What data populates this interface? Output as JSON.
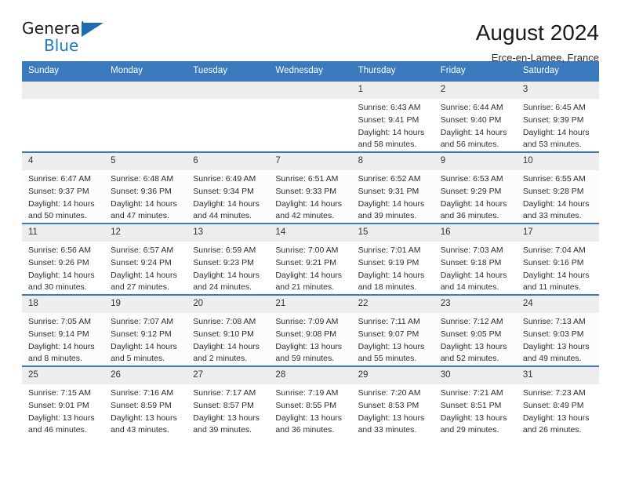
{
  "brand": {
    "name_top": "General",
    "name_bottom": "Blue",
    "triangle_color": "#1b6cb3",
    "blue_text_color": "#1f7ac4"
  },
  "header": {
    "title": "August 2024",
    "location": "Erce-en-Lamee, France"
  },
  "theme": {
    "header_blue": "#3a7abd",
    "daynum_band": "#ededed",
    "row_separator": "#3a7abd"
  },
  "columns": [
    "Sunday",
    "Monday",
    "Tuesday",
    "Wednesday",
    "Thursday",
    "Friday",
    "Saturday"
  ],
  "weeks": [
    [
      {
        "day": "",
        "empty": true,
        "sunrise": "",
        "sunset": "",
        "daylight1": "",
        "daylight2": ""
      },
      {
        "day": "",
        "empty": true,
        "sunrise": "",
        "sunset": "",
        "daylight1": "",
        "daylight2": ""
      },
      {
        "day": "",
        "empty": true,
        "sunrise": "",
        "sunset": "",
        "daylight1": "",
        "daylight2": ""
      },
      {
        "day": "",
        "empty": true,
        "sunrise": "",
        "sunset": "",
        "daylight1": "",
        "daylight2": ""
      },
      {
        "day": "1",
        "sunrise": "Sunrise: 6:43 AM",
        "sunset": "Sunset: 9:41 PM",
        "daylight1": "Daylight: 14 hours",
        "daylight2": "and 58 minutes."
      },
      {
        "day": "2",
        "sunrise": "Sunrise: 6:44 AM",
        "sunset": "Sunset: 9:40 PM",
        "daylight1": "Daylight: 14 hours",
        "daylight2": "and 56 minutes."
      },
      {
        "day": "3",
        "sunrise": "Sunrise: 6:45 AM",
        "sunset": "Sunset: 9:39 PM",
        "daylight1": "Daylight: 14 hours",
        "daylight2": "and 53 minutes."
      }
    ],
    [
      {
        "day": "4",
        "sunrise": "Sunrise: 6:47 AM",
        "sunset": "Sunset: 9:37 PM",
        "daylight1": "Daylight: 14 hours",
        "daylight2": "and 50 minutes."
      },
      {
        "day": "5",
        "sunrise": "Sunrise: 6:48 AM",
        "sunset": "Sunset: 9:36 PM",
        "daylight1": "Daylight: 14 hours",
        "daylight2": "and 47 minutes."
      },
      {
        "day": "6",
        "sunrise": "Sunrise: 6:49 AM",
        "sunset": "Sunset: 9:34 PM",
        "daylight1": "Daylight: 14 hours",
        "daylight2": "and 44 minutes."
      },
      {
        "day": "7",
        "sunrise": "Sunrise: 6:51 AM",
        "sunset": "Sunset: 9:33 PM",
        "daylight1": "Daylight: 14 hours",
        "daylight2": "and 42 minutes."
      },
      {
        "day": "8",
        "sunrise": "Sunrise: 6:52 AM",
        "sunset": "Sunset: 9:31 PM",
        "daylight1": "Daylight: 14 hours",
        "daylight2": "and 39 minutes."
      },
      {
        "day": "9",
        "sunrise": "Sunrise: 6:53 AM",
        "sunset": "Sunset: 9:29 PM",
        "daylight1": "Daylight: 14 hours",
        "daylight2": "and 36 minutes."
      },
      {
        "day": "10",
        "sunrise": "Sunrise: 6:55 AM",
        "sunset": "Sunset: 9:28 PM",
        "daylight1": "Daylight: 14 hours",
        "daylight2": "and 33 minutes."
      }
    ],
    [
      {
        "day": "11",
        "sunrise": "Sunrise: 6:56 AM",
        "sunset": "Sunset: 9:26 PM",
        "daylight1": "Daylight: 14 hours",
        "daylight2": "and 30 minutes."
      },
      {
        "day": "12",
        "sunrise": "Sunrise: 6:57 AM",
        "sunset": "Sunset: 9:24 PM",
        "daylight1": "Daylight: 14 hours",
        "daylight2": "and 27 minutes."
      },
      {
        "day": "13",
        "sunrise": "Sunrise: 6:59 AM",
        "sunset": "Sunset: 9:23 PM",
        "daylight1": "Daylight: 14 hours",
        "daylight2": "and 24 minutes."
      },
      {
        "day": "14",
        "sunrise": "Sunrise: 7:00 AM",
        "sunset": "Sunset: 9:21 PM",
        "daylight1": "Daylight: 14 hours",
        "daylight2": "and 21 minutes."
      },
      {
        "day": "15",
        "sunrise": "Sunrise: 7:01 AM",
        "sunset": "Sunset: 9:19 PM",
        "daylight1": "Daylight: 14 hours",
        "daylight2": "and 18 minutes."
      },
      {
        "day": "16",
        "sunrise": "Sunrise: 7:03 AM",
        "sunset": "Sunset: 9:18 PM",
        "daylight1": "Daylight: 14 hours",
        "daylight2": "and 14 minutes."
      },
      {
        "day": "17",
        "sunrise": "Sunrise: 7:04 AM",
        "sunset": "Sunset: 9:16 PM",
        "daylight1": "Daylight: 14 hours",
        "daylight2": "and 11 minutes."
      }
    ],
    [
      {
        "day": "18",
        "sunrise": "Sunrise: 7:05 AM",
        "sunset": "Sunset: 9:14 PM",
        "daylight1": "Daylight: 14 hours",
        "daylight2": "and 8 minutes."
      },
      {
        "day": "19",
        "sunrise": "Sunrise: 7:07 AM",
        "sunset": "Sunset: 9:12 PM",
        "daylight1": "Daylight: 14 hours",
        "daylight2": "and 5 minutes."
      },
      {
        "day": "20",
        "sunrise": "Sunrise: 7:08 AM",
        "sunset": "Sunset: 9:10 PM",
        "daylight1": "Daylight: 14 hours",
        "daylight2": "and 2 minutes."
      },
      {
        "day": "21",
        "sunrise": "Sunrise: 7:09 AM",
        "sunset": "Sunset: 9:08 PM",
        "daylight1": "Daylight: 13 hours",
        "daylight2": "and 59 minutes."
      },
      {
        "day": "22",
        "sunrise": "Sunrise: 7:11 AM",
        "sunset": "Sunset: 9:07 PM",
        "daylight1": "Daylight: 13 hours",
        "daylight2": "and 55 minutes."
      },
      {
        "day": "23",
        "sunrise": "Sunrise: 7:12 AM",
        "sunset": "Sunset: 9:05 PM",
        "daylight1": "Daylight: 13 hours",
        "daylight2": "and 52 minutes."
      },
      {
        "day": "24",
        "sunrise": "Sunrise: 7:13 AM",
        "sunset": "Sunset: 9:03 PM",
        "daylight1": "Daylight: 13 hours",
        "daylight2": "and 49 minutes."
      }
    ],
    [
      {
        "day": "25",
        "sunrise": "Sunrise: 7:15 AM",
        "sunset": "Sunset: 9:01 PM",
        "daylight1": "Daylight: 13 hours",
        "daylight2": "and 46 minutes."
      },
      {
        "day": "26",
        "sunrise": "Sunrise: 7:16 AM",
        "sunset": "Sunset: 8:59 PM",
        "daylight1": "Daylight: 13 hours",
        "daylight2": "and 43 minutes."
      },
      {
        "day": "27",
        "sunrise": "Sunrise: 7:17 AM",
        "sunset": "Sunset: 8:57 PM",
        "daylight1": "Daylight: 13 hours",
        "daylight2": "and 39 minutes."
      },
      {
        "day": "28",
        "sunrise": "Sunrise: 7:19 AM",
        "sunset": "Sunset: 8:55 PM",
        "daylight1": "Daylight: 13 hours",
        "daylight2": "and 36 minutes."
      },
      {
        "day": "29",
        "sunrise": "Sunrise: 7:20 AM",
        "sunset": "Sunset: 8:53 PM",
        "daylight1": "Daylight: 13 hours",
        "daylight2": "and 33 minutes."
      },
      {
        "day": "30",
        "sunrise": "Sunrise: 7:21 AM",
        "sunset": "Sunset: 8:51 PM",
        "daylight1": "Daylight: 13 hours",
        "daylight2": "and 29 minutes."
      },
      {
        "day": "31",
        "sunrise": "Sunrise: 7:23 AM",
        "sunset": "Sunset: 8:49 PM",
        "daylight1": "Daylight: 13 hours",
        "daylight2": "and 26 minutes."
      }
    ]
  ]
}
